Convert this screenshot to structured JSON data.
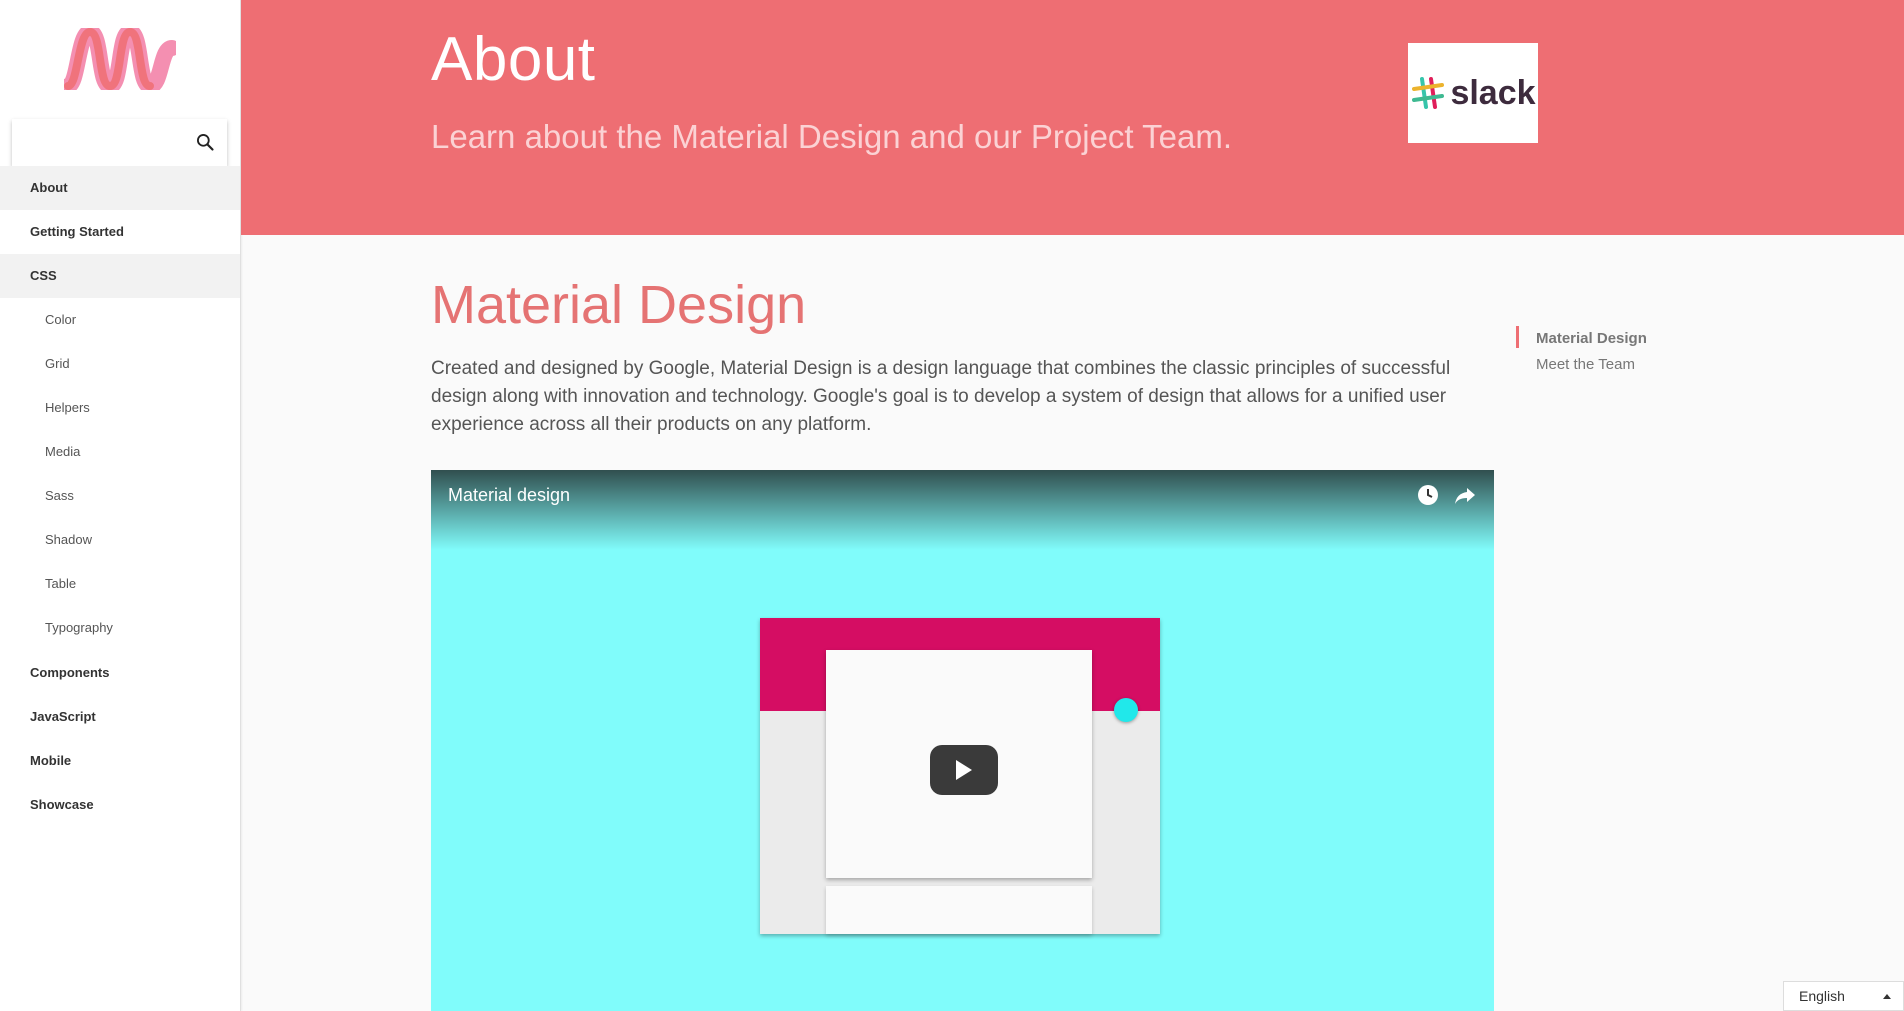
{
  "sidebar": {
    "logo": "M",
    "search": {
      "placeholder": "",
      "value": ""
    },
    "items": [
      {
        "label": "About",
        "level": "top",
        "active": true
      },
      {
        "label": "Getting Started",
        "level": "top"
      },
      {
        "label": "CSS",
        "level": "top",
        "active": true
      },
      {
        "label": "Color",
        "level": "sub"
      },
      {
        "label": "Grid",
        "level": "sub"
      },
      {
        "label": "Helpers",
        "level": "sub"
      },
      {
        "label": "Media",
        "level": "sub"
      },
      {
        "label": "Sass",
        "level": "sub"
      },
      {
        "label": "Shadow",
        "level": "sub"
      },
      {
        "label": "Table",
        "level": "sub"
      },
      {
        "label": "Typography",
        "level": "sub"
      },
      {
        "label": "Components",
        "level": "top"
      },
      {
        "label": "JavaScript",
        "level": "top"
      },
      {
        "label": "Mobile",
        "level": "top"
      },
      {
        "label": "Showcase",
        "level": "top"
      }
    ]
  },
  "header": {
    "title": "About",
    "subtitle": "Learn about the Material Design and our Project Team.",
    "badge_text": "slack",
    "bg_color": "#ee6e73"
  },
  "main": {
    "heading": "Material Design",
    "paragraph": "Created and designed by Google, Material Design is a design language that combines the classic principles of successful design along with innovation and technology. Google's goal is to develop a system of design that allows for a unified user experience across all their products on any platform.",
    "video": {
      "title": "Material design",
      "icons": [
        "watch-later-icon",
        "share-icon",
        "play-icon"
      ]
    }
  },
  "toc": {
    "items": [
      {
        "label": "Material Design",
        "current": true
      },
      {
        "label": "Meet the Team"
      }
    ]
  },
  "language": {
    "selected": "English"
  }
}
